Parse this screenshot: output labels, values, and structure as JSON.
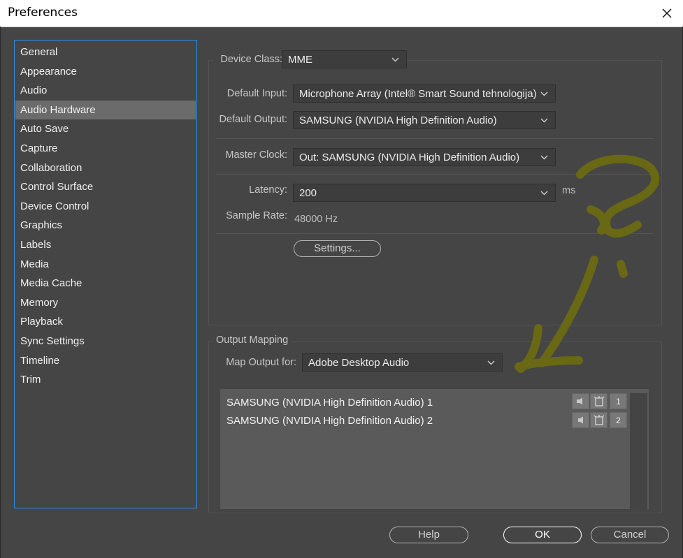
{
  "window": {
    "title": "Preferences"
  },
  "sidebar": {
    "items": [
      {
        "label": "General"
      },
      {
        "label": "Appearance"
      },
      {
        "label": "Audio"
      },
      {
        "label": "Audio Hardware"
      },
      {
        "label": "Auto Save"
      },
      {
        "label": "Capture"
      },
      {
        "label": "Collaboration"
      },
      {
        "label": "Control Surface"
      },
      {
        "label": "Device Control"
      },
      {
        "label": "Graphics"
      },
      {
        "label": "Labels"
      },
      {
        "label": "Media"
      },
      {
        "label": "Media Cache"
      },
      {
        "label": "Memory"
      },
      {
        "label": "Playback"
      },
      {
        "label": "Sync Settings"
      },
      {
        "label": "Timeline"
      },
      {
        "label": "Trim"
      }
    ],
    "selected": "Audio Hardware"
  },
  "hardware": {
    "device_class_label": "Device Class:",
    "device_class_value": "MME",
    "default_input_label": "Default Input:",
    "default_input_value": "Microphone Array (Intel® Smart Sound tehnologija)",
    "default_output_label": "Default Output:",
    "default_output_value": "SAMSUNG (NVIDIA High Definition Audio)",
    "master_clock_label": "Master Clock:",
    "master_clock_value": "Out: SAMSUNG (NVIDIA High Definition Audio)",
    "latency_label": "Latency:",
    "latency_value": "200",
    "latency_unit": "ms",
    "sample_rate_label": "Sample Rate:",
    "sample_rate_value": "48000 Hz",
    "settings_button": "Settings..."
  },
  "output_mapping": {
    "section_title": "Output Mapping",
    "map_output_label": "Map Output for:",
    "map_output_value": "Adobe Desktop Audio",
    "channels": [
      {
        "name": "SAMSUNG (NVIDIA High Definition Audio) 1",
        "index": "1"
      },
      {
        "name": "SAMSUNG (NVIDIA High Definition Audio) 2",
        "index": "2"
      }
    ]
  },
  "footer": {
    "help": "Help",
    "ok": "OK",
    "cancel": "Cancel"
  },
  "colors": {
    "background": "#454545",
    "sidebar_focus_border": "#2d8ceb",
    "sidebar_selected": "#6b6b6b",
    "annotation": "#6b6a12"
  },
  "annotation": {
    "type": "hand-drawn question mark and arrow",
    "color": "#6b6a12"
  }
}
